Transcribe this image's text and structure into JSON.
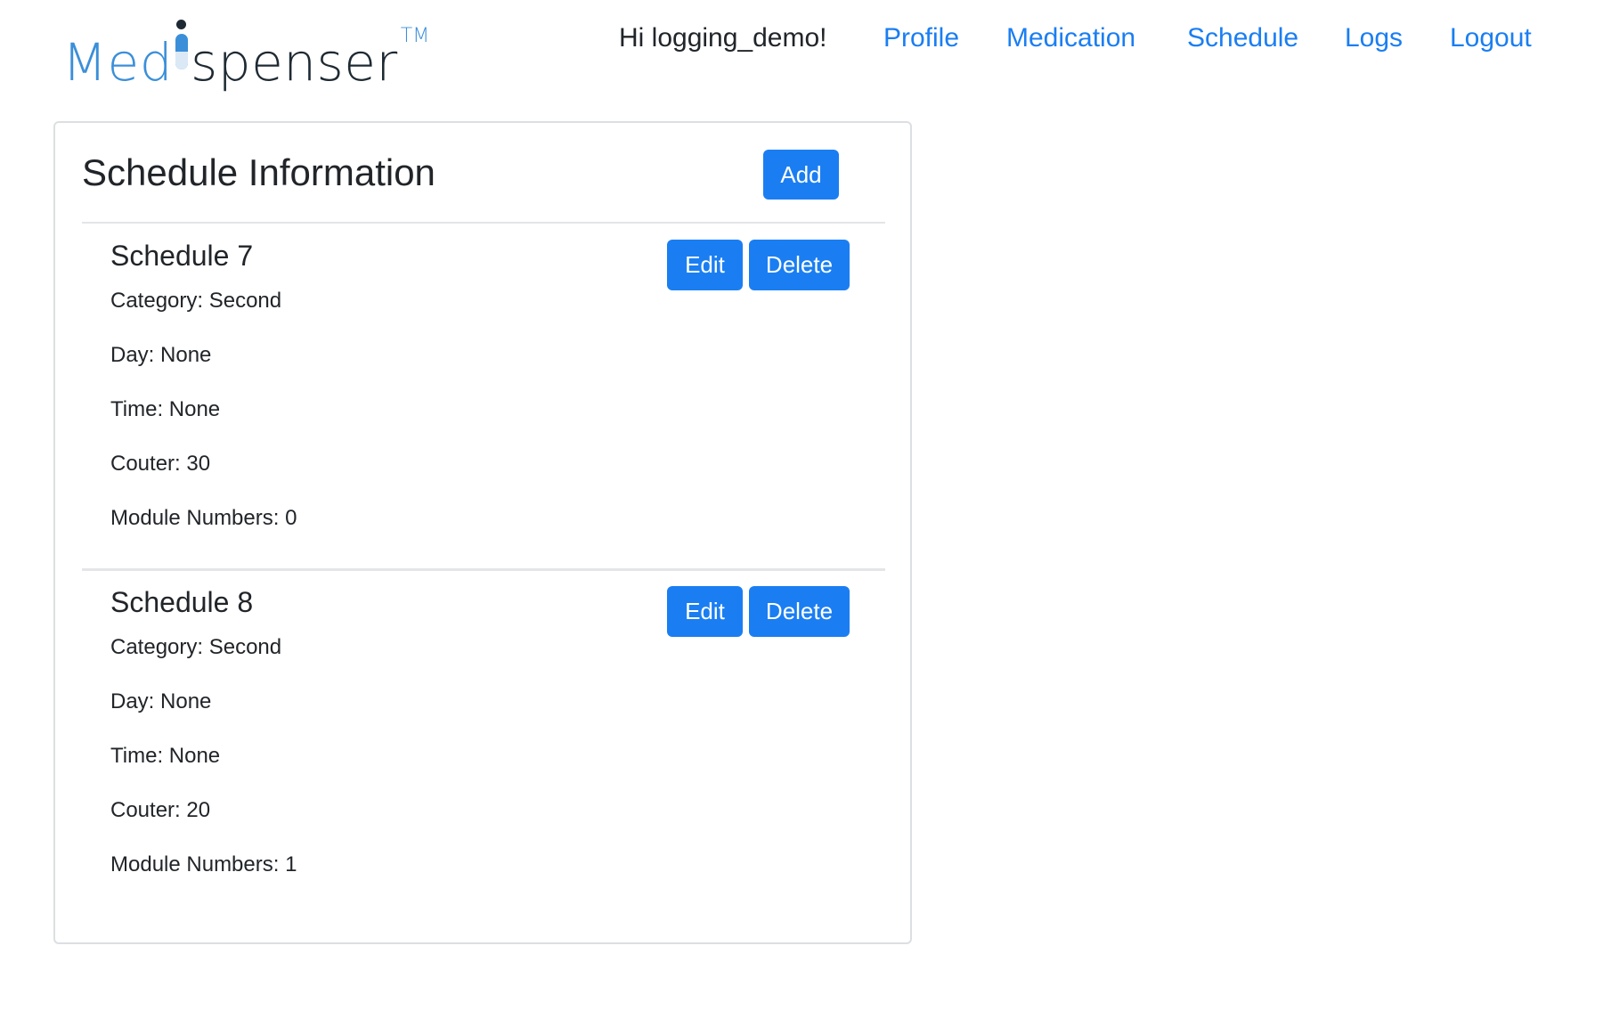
{
  "brand": {
    "part1": "Med",
    "part2": "spenser",
    "trademark": "TM"
  },
  "nav": {
    "greeting": "Hi logging_demo!",
    "links": [
      "Profile",
      "Medication",
      "Schedule",
      "Logs",
      "Logout"
    ]
  },
  "card": {
    "title": "Schedule Information",
    "add_label": "Add"
  },
  "schedules": [
    {
      "title": "Schedule 7",
      "category": "Category: Second",
      "day": "Day: None",
      "time": "Time: None",
      "couter": "Couter: 30",
      "module_numbers": "Module Numbers: 0",
      "edit_label": "Edit",
      "delete_label": "Delete"
    },
    {
      "title": "Schedule 8",
      "category": "Category: Second",
      "day": "Day: None",
      "time": "Time: None",
      "couter": "Couter: 20",
      "module_numbers": "Module Numbers: 1",
      "edit_label": "Edit",
      "delete_label": "Delete"
    }
  ],
  "colors": {
    "accent": "#1a7ef2",
    "logo_blue": "#3b8fd9",
    "text": "#212529",
    "border": "#dcdfe2"
  }
}
